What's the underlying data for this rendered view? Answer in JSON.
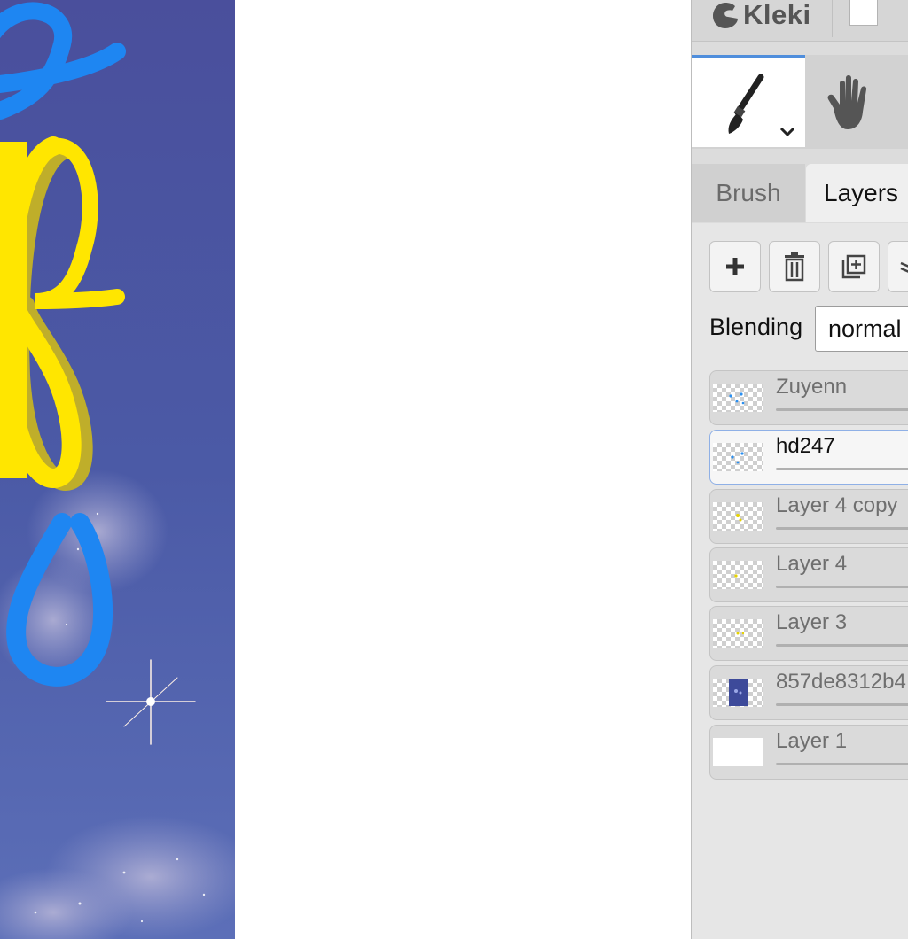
{
  "app": {
    "name": "Kleki"
  },
  "colors": {
    "accent": "#4f8edc",
    "primary_color": "#ffffff"
  },
  "tools": [
    {
      "name": "brush",
      "icon": "brush-icon",
      "active": true
    },
    {
      "name": "hand",
      "icon": "hand-icon",
      "active": false
    }
  ],
  "tabs": {
    "brush": "Brush",
    "layers": "Layers"
  },
  "layer_toolbar": [
    "add-layer-icon",
    "delete-layer-icon",
    "duplicate-layer-icon",
    "merge-layer-icon"
  ],
  "blending": {
    "label": "Blending",
    "value": "normal"
  },
  "layers": [
    {
      "name": "Zuyenn",
      "selected": false
    },
    {
      "name": "hd247",
      "selected": true
    },
    {
      "name": "Layer 4 copy",
      "selected": false
    },
    {
      "name": "Layer 4",
      "selected": false
    },
    {
      "name": "Layer 3",
      "selected": false
    },
    {
      "name": "857de8312b4",
      "selected": false
    },
    {
      "name": "Layer 1",
      "selected": false
    }
  ]
}
